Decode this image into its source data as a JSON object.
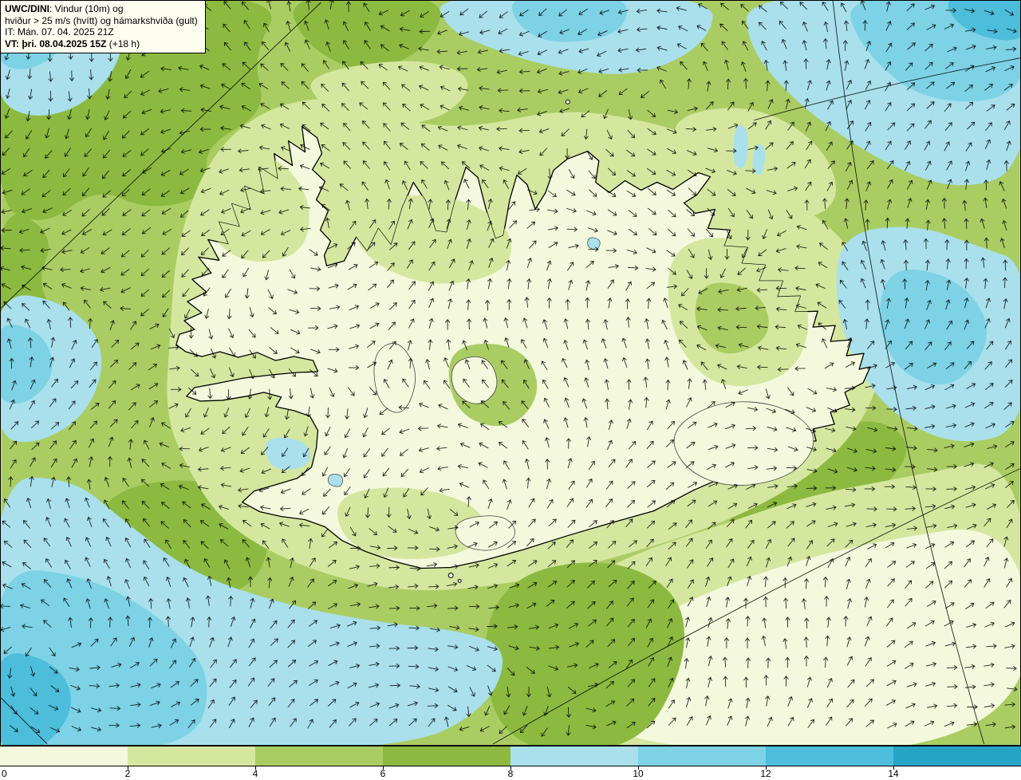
{
  "info_box": {
    "line1_bold": "UWC/DINI",
    "line1_rest": ": Vindur (10m) og",
    "line2": "hviður > 25 m/s (hvítt) og hámarkshviða (gult)",
    "line3": "IT: Mán. 07. 04. 2025 21Z",
    "line4_bold": "VT: þri. 08.04.2025 15Z",
    "line4_rest": " (+18 h)"
  },
  "legend": {
    "tick_labels": [
      "0",
      "2",
      "4",
      "6",
      "8",
      "10",
      "12",
      "14"
    ],
    "band_colors": [
      "#f4f8dd",
      "#d5e79f",
      "#aacd63",
      "#8cba40",
      "#a9e0ec",
      "#7dd2e5",
      "#4cbedb",
      "#27a3c6"
    ]
  },
  "map": {
    "region": "Iceland",
    "coastline_color": "#000000",
    "arrow_color": "#000000",
    "graticule_color": "#000000",
    "glacier_outline_color": "#444444"
  }
}
